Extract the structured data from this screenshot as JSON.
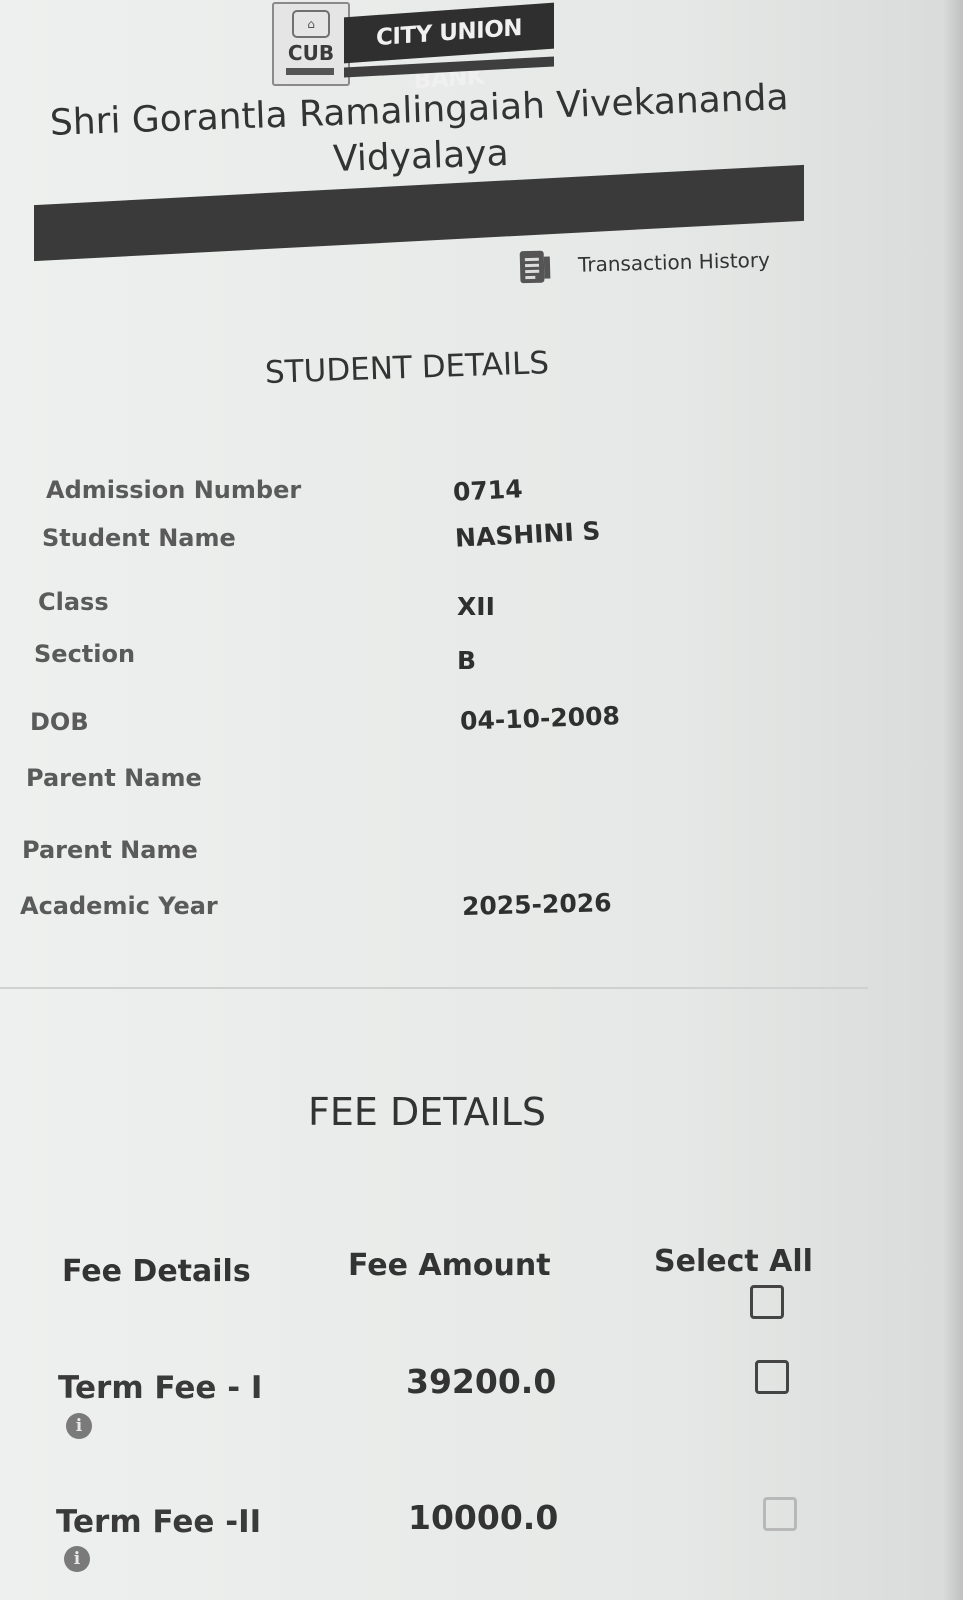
{
  "header": {
    "bank_name": "CITY UNION BANK",
    "bank_abbr": "CUB",
    "school_name": "Shri Gorantla Ramalingaiah Vivekananda Vidyalaya",
    "transaction_history_label": "Transaction History"
  },
  "student_details": {
    "title": "STUDENT DETAILS",
    "rows": [
      {
        "label": "Admission Number",
        "value": "0714"
      },
      {
        "label": "Student Name",
        "value": "NASHINI S"
      },
      {
        "label": "Class",
        "value": "XII"
      },
      {
        "label": "Section",
        "value": "B"
      },
      {
        "label": "DOB",
        "value": "04-10-2008"
      },
      {
        "label": "Parent Name",
        "value": ""
      },
      {
        "label": "Parent Name",
        "value": ""
      },
      {
        "label": "Academic Year",
        "value": "2025-2026"
      }
    ]
  },
  "fee_details": {
    "title": "FEE DETAILS",
    "columns": {
      "details": "Fee Details",
      "amount": "Fee Amount",
      "select_all": "Select All"
    },
    "rows": [
      {
        "name": "Term Fee - I",
        "amount": "39200.0",
        "checked": false,
        "enabled": true
      },
      {
        "name": "Term Fee -II",
        "amount": "10000.0",
        "checked": false,
        "enabled": false
      }
    ]
  }
}
